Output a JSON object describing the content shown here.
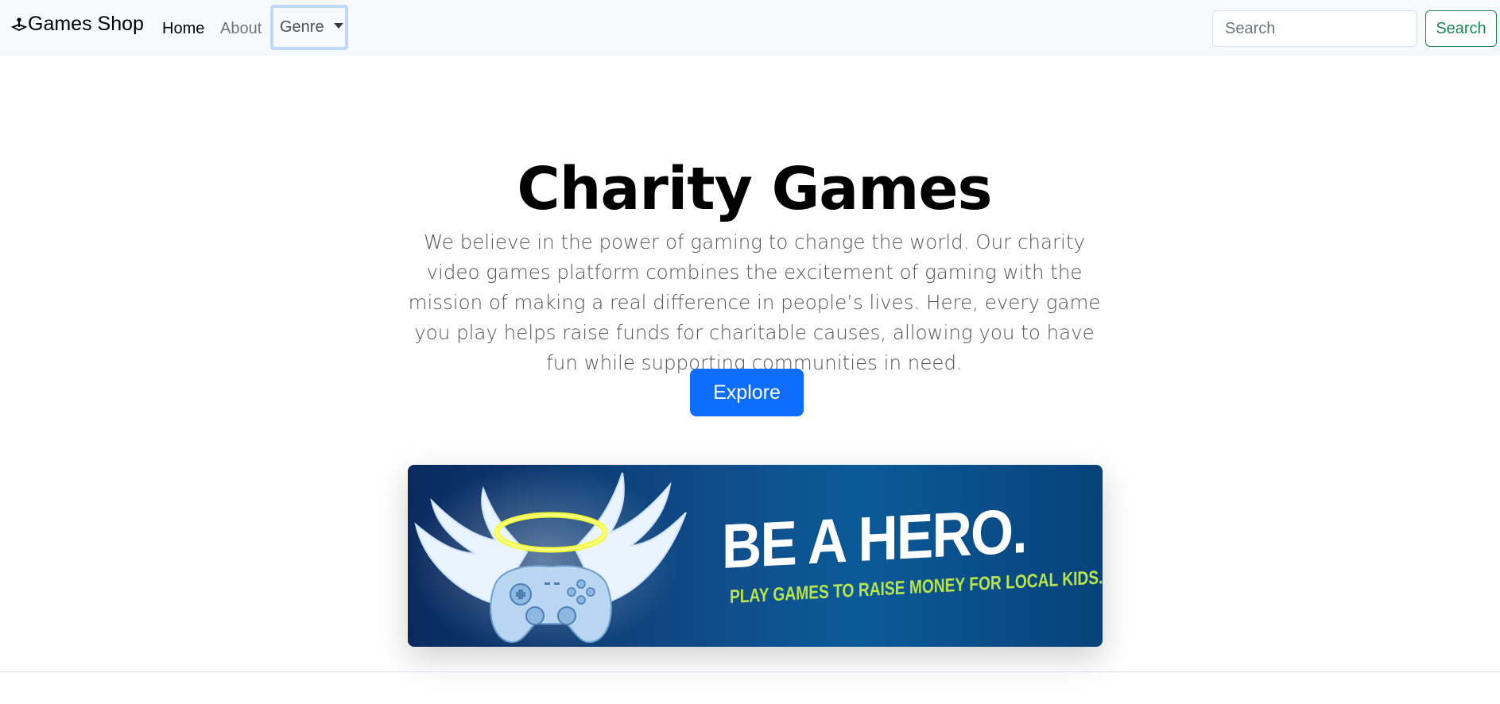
{
  "navbar": {
    "brand": "Games Shop",
    "links": [
      "Home",
      "About"
    ],
    "dropdown_label": "Genre",
    "search_placeholder": "Search",
    "search_button": "Search"
  },
  "hero": {
    "title": "Charity Games",
    "description": "We believe in the power of gaming to change the world. Our charity video games platform combines the excitement of gaming with the mission of making a real difference in people’s lives. Here, every game you play helps raise funds for charitable causes, allowing you to have fun while supporting communities in need.",
    "button": "Explore"
  },
  "banner": {
    "headline": "BE A HERO.",
    "subline": "PLAY GAMES TO RAISE MONEY FOR LOCAL KIDS."
  },
  "colors": {
    "primary": "#0d6efd",
    "success": "#198754",
    "navbar_bg": "#f8f9fa"
  }
}
